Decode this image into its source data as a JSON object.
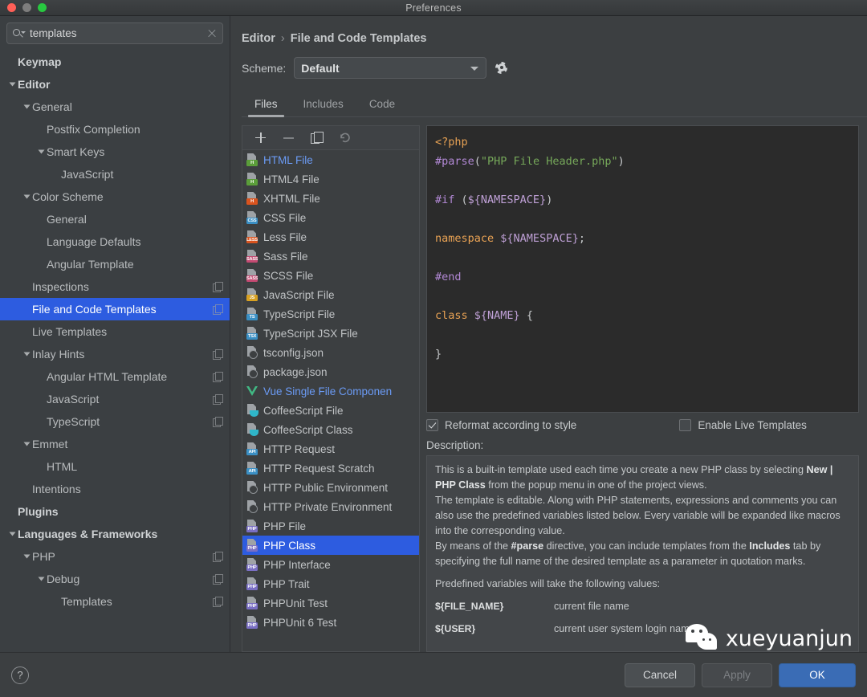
{
  "window": {
    "title": "Preferences",
    "traffic_lights": [
      "close",
      "minimize",
      "zoom"
    ]
  },
  "sidebar": {
    "search": {
      "value": "templates",
      "placeholder": "Search"
    },
    "items": [
      {
        "label": "Keymap",
        "depth": 0,
        "arrow": false,
        "bold": true,
        "badge": false,
        "selected": false
      },
      {
        "label": "Editor",
        "depth": 0,
        "arrow": true,
        "bold": true,
        "badge": false,
        "selected": false
      },
      {
        "label": "General",
        "depth": 1,
        "arrow": true,
        "bold": false,
        "badge": false,
        "selected": false
      },
      {
        "label": "Postfix Completion",
        "depth": 2,
        "arrow": false,
        "bold": false,
        "badge": false,
        "selected": false
      },
      {
        "label": "Smart Keys",
        "depth": 2,
        "arrow": true,
        "bold": false,
        "badge": false,
        "selected": false
      },
      {
        "label": "JavaScript",
        "depth": 3,
        "arrow": false,
        "bold": false,
        "badge": false,
        "selected": false
      },
      {
        "label": "Color Scheme",
        "depth": 1,
        "arrow": true,
        "bold": false,
        "badge": false,
        "selected": false
      },
      {
        "label": "General",
        "depth": 2,
        "arrow": false,
        "bold": false,
        "badge": false,
        "selected": false
      },
      {
        "label": "Language Defaults",
        "depth": 2,
        "arrow": false,
        "bold": false,
        "badge": false,
        "selected": false
      },
      {
        "label": "Angular Template",
        "depth": 2,
        "arrow": false,
        "bold": false,
        "badge": false,
        "selected": false
      },
      {
        "label": "Inspections",
        "depth": 1,
        "arrow": false,
        "bold": false,
        "badge": true,
        "selected": false
      },
      {
        "label": "File and Code Templates",
        "depth": 1,
        "arrow": false,
        "bold": false,
        "badge": true,
        "selected": true
      },
      {
        "label": "Live Templates",
        "depth": 1,
        "arrow": false,
        "bold": false,
        "badge": false,
        "selected": false
      },
      {
        "label": "Inlay Hints",
        "depth": 1,
        "arrow": true,
        "bold": false,
        "badge": true,
        "selected": false
      },
      {
        "label": "Angular HTML Template",
        "depth": 2,
        "arrow": false,
        "bold": false,
        "badge": true,
        "selected": false
      },
      {
        "label": "JavaScript",
        "depth": 2,
        "arrow": false,
        "bold": false,
        "badge": true,
        "selected": false
      },
      {
        "label": "TypeScript",
        "depth": 2,
        "arrow": false,
        "bold": false,
        "badge": true,
        "selected": false
      },
      {
        "label": "Emmet",
        "depth": 1,
        "arrow": true,
        "bold": false,
        "badge": false,
        "selected": false
      },
      {
        "label": "HTML",
        "depth": 2,
        "arrow": false,
        "bold": false,
        "badge": false,
        "selected": false
      },
      {
        "label": "Intentions",
        "depth": 1,
        "arrow": false,
        "bold": false,
        "badge": false,
        "selected": false
      },
      {
        "label": "Plugins",
        "depth": 0,
        "arrow": false,
        "bold": true,
        "badge": false,
        "selected": false
      },
      {
        "label": "Languages & Frameworks",
        "depth": 0,
        "arrow": true,
        "bold": true,
        "badge": false,
        "selected": false
      },
      {
        "label": "PHP",
        "depth": 1,
        "arrow": true,
        "bold": false,
        "badge": true,
        "selected": false
      },
      {
        "label": "Debug",
        "depth": 2,
        "arrow": true,
        "bold": false,
        "badge": true,
        "selected": false
      },
      {
        "label": "Templates",
        "depth": 3,
        "arrow": false,
        "bold": false,
        "badge": true,
        "selected": false
      }
    ]
  },
  "breadcrumb": {
    "parent": "Editor",
    "separator": "›",
    "current": "File and Code Templates"
  },
  "scheme": {
    "label": "Scheme:",
    "value": "Default",
    "gear_icon": "gear-icon"
  },
  "tabs": [
    {
      "label": "Files",
      "active": true
    },
    {
      "label": "Includes",
      "active": false
    },
    {
      "label": "Code",
      "active": false
    }
  ],
  "list_toolbar": [
    {
      "name": "add-template-button",
      "icon": "plus-icon"
    },
    {
      "name": "remove-template-button",
      "icon": "minus-icon"
    },
    {
      "name": "copy-template-button",
      "icon": "copy-icon"
    },
    {
      "name": "reset-template-button",
      "icon": "revert-arrow-icon"
    }
  ],
  "templates": [
    {
      "label": "HTML File",
      "icon": "html-file-icon",
      "badge": "H",
      "badge_color": "#5b9e3a",
      "style": "blue",
      "selected": false
    },
    {
      "label": "HTML4 File",
      "icon": "html-file-icon",
      "badge": "H",
      "badge_color": "#5b9e3a",
      "style": "",
      "selected": false
    },
    {
      "label": "XHTML File",
      "icon": "xhtml-file-icon",
      "badge": "H",
      "badge_color": "#d9531e",
      "style": "",
      "selected": false
    },
    {
      "label": "CSS File",
      "icon": "css-file-icon",
      "badge": "CSS",
      "badge_color": "#3a8fc4",
      "style": "",
      "selected": false
    },
    {
      "label": "Less File",
      "icon": "less-file-icon",
      "badge": "LESS",
      "badge_color": "#d9531e",
      "style": "",
      "selected": false
    },
    {
      "label": "Sass File",
      "icon": "sass-file-icon",
      "badge": "SASS",
      "badge_color": "#c44a72",
      "style": "",
      "selected": false
    },
    {
      "label": "SCSS File",
      "icon": "scss-file-icon",
      "badge": "SASS",
      "badge_color": "#c44a72",
      "style": "",
      "selected": false
    },
    {
      "label": "JavaScript File",
      "icon": "javascript-file-icon",
      "badge": "JS",
      "badge_color": "#d7a021",
      "style": "",
      "selected": false
    },
    {
      "label": "TypeScript File",
      "icon": "typescript-file-icon",
      "badge": "TS",
      "badge_color": "#3a8fc4",
      "style": "",
      "selected": false
    },
    {
      "label": "TypeScript JSX File",
      "icon": "typescript-jsx-file-icon",
      "badge": "TSX",
      "badge_color": "#3a8fc4",
      "style": "",
      "selected": false
    },
    {
      "label": "tsconfig.json",
      "icon": "json-file-icon",
      "badge": "",
      "badge_color": "",
      "style": "json",
      "selected": false
    },
    {
      "label": "package.json",
      "icon": "json-file-icon",
      "badge": "",
      "badge_color": "",
      "style": "json",
      "selected": false
    },
    {
      "label": "Vue Single File Componen",
      "icon": "vue-file-icon",
      "badge": "",
      "badge_color": "#41b883",
      "style": "blue vue",
      "selected": false
    },
    {
      "label": "CoffeeScript File",
      "icon": "coffeescript-file-icon",
      "badge": "",
      "badge_color": "#2fb6c9",
      "style": "coffee",
      "selected": false
    },
    {
      "label": "CoffeeScript Class",
      "icon": "coffeescript-file-icon",
      "badge": "",
      "badge_color": "#2fb6c9",
      "style": "coffee",
      "selected": false
    },
    {
      "label": "HTTP Request",
      "icon": "http-request-icon",
      "badge": "API",
      "badge_color": "#3a8fc4",
      "style": "",
      "selected": false
    },
    {
      "label": "HTTP Request Scratch",
      "icon": "http-request-icon",
      "badge": "API",
      "badge_color": "#3a8fc4",
      "style": "",
      "selected": false
    },
    {
      "label": "HTTP Public Environment",
      "icon": "json-file-icon",
      "badge": "",
      "badge_color": "",
      "style": "json",
      "selected": false
    },
    {
      "label": "HTTP Private Environment",
      "icon": "json-file-icon",
      "badge": "",
      "badge_color": "",
      "style": "json",
      "selected": false
    },
    {
      "label": "PHP File",
      "icon": "php-file-icon",
      "badge": "PHP",
      "badge_color": "#7a6fc4",
      "style": "",
      "selected": false
    },
    {
      "label": "PHP Class",
      "icon": "php-file-icon",
      "badge": "PHP",
      "badge_color": "#7a6fc4",
      "style": "",
      "selected": true
    },
    {
      "label": "PHP Interface",
      "icon": "php-file-icon",
      "badge": "PHP",
      "badge_color": "#7a6fc4",
      "style": "",
      "selected": false
    },
    {
      "label": "PHP Trait",
      "icon": "php-file-icon",
      "badge": "PHP",
      "badge_color": "#7a6fc4",
      "style": "",
      "selected": false
    },
    {
      "label": "PHPUnit Test",
      "icon": "php-file-icon",
      "badge": "PHP",
      "badge_color": "#7a6fc4",
      "style": "",
      "selected": false
    },
    {
      "label": "PHPUnit 6 Test",
      "icon": "php-file-icon",
      "badge": "PHP",
      "badge_color": "#7a6fc4",
      "style": "",
      "selected": false
    }
  ],
  "editor": {
    "lines": [
      [
        {
          "t": "<?php",
          "c": "k-tag"
        }
      ],
      [
        {
          "t": "#parse",
          "c": "k-dir"
        },
        {
          "t": "(",
          "c": "k-punc"
        },
        {
          "t": "\"PHP File Header.php\"",
          "c": "k-str"
        },
        {
          "t": ")",
          "c": "k-punc"
        }
      ],
      [
        {
          "t": "",
          "c": "k-plain"
        }
      ],
      [
        {
          "t": "#if",
          "c": "k-dir"
        },
        {
          "t": " (",
          "c": "k-punc"
        },
        {
          "t": "${NAMESPACE}",
          "c": "k-var"
        },
        {
          "t": ")",
          "c": "k-punc"
        }
      ],
      [
        {
          "t": "",
          "c": "k-plain"
        }
      ],
      [
        {
          "t": "namespace",
          "c": "k-kw"
        },
        {
          "t": " ",
          "c": "k-plain"
        },
        {
          "t": "${NAMESPACE}",
          "c": "k-var"
        },
        {
          "t": ";",
          "c": "k-punc"
        }
      ],
      [
        {
          "t": "",
          "c": "k-plain"
        }
      ],
      [
        {
          "t": "#end",
          "c": "k-dir"
        }
      ],
      [
        {
          "t": "",
          "c": "k-plain"
        }
      ],
      [
        {
          "t": "class",
          "c": "k-kw"
        },
        {
          "t": " ",
          "c": "k-plain"
        },
        {
          "t": "${NAME}",
          "c": "k-var"
        },
        {
          "t": " {",
          "c": "k-punc"
        }
      ],
      [
        {
          "t": "",
          "c": "k-plain"
        }
      ],
      [
        {
          "t": "}",
          "c": "k-punc"
        }
      ]
    ]
  },
  "options": {
    "reformat": {
      "label": "Reformat according to style",
      "checked": true
    },
    "live_templates": {
      "label": "Enable Live Templates",
      "checked": false
    }
  },
  "description": {
    "label": "Description:",
    "paragraphs": [
      [
        {
          "t": "This is a built-in template used each time you create a new PHP class by selecting ",
          "b": false
        },
        {
          "t": "New | PHP Class",
          "b": true
        },
        {
          "t": " from the popup menu in one of the project views.",
          "b": false
        }
      ],
      [
        {
          "t": "The template is editable. Along with PHP statements, expressions and comments you can also use the predefined variables listed below. Every variable will be expanded like macros into the corresponding value.",
          "b": false
        }
      ],
      [
        {
          "t": "By means of the ",
          "b": false
        },
        {
          "t": "#parse",
          "b": true
        },
        {
          "t": " directive, you can include templates from the ",
          "b": false
        },
        {
          "t": "Includes",
          "b": true
        },
        {
          "t": " tab by specifying the full name of the desired template as a parameter in quotation marks.",
          "b": false
        }
      ],
      [
        {
          "t": "Predefined variables will take the following values:",
          "b": false
        }
      ]
    ],
    "variables": [
      {
        "name": "${FILE_NAME}",
        "desc": "current file name"
      },
      {
        "name": "${USER}",
        "desc": "current user system login name"
      }
    ]
  },
  "footer": {
    "help_label": "?",
    "cancel_label": "Cancel",
    "apply_label": "Apply",
    "ok_label": "OK"
  },
  "watermark": {
    "text": "xueyuanjun",
    "icon": "wechat-icon"
  },
  "colors": {
    "selection_blue": "#2d5ce0",
    "ok_button_blue": "#3a6cb5",
    "window_bg": "#3c3f41",
    "editor_bg": "#2b2b2b",
    "link_blue": "#6b9bf5"
  }
}
